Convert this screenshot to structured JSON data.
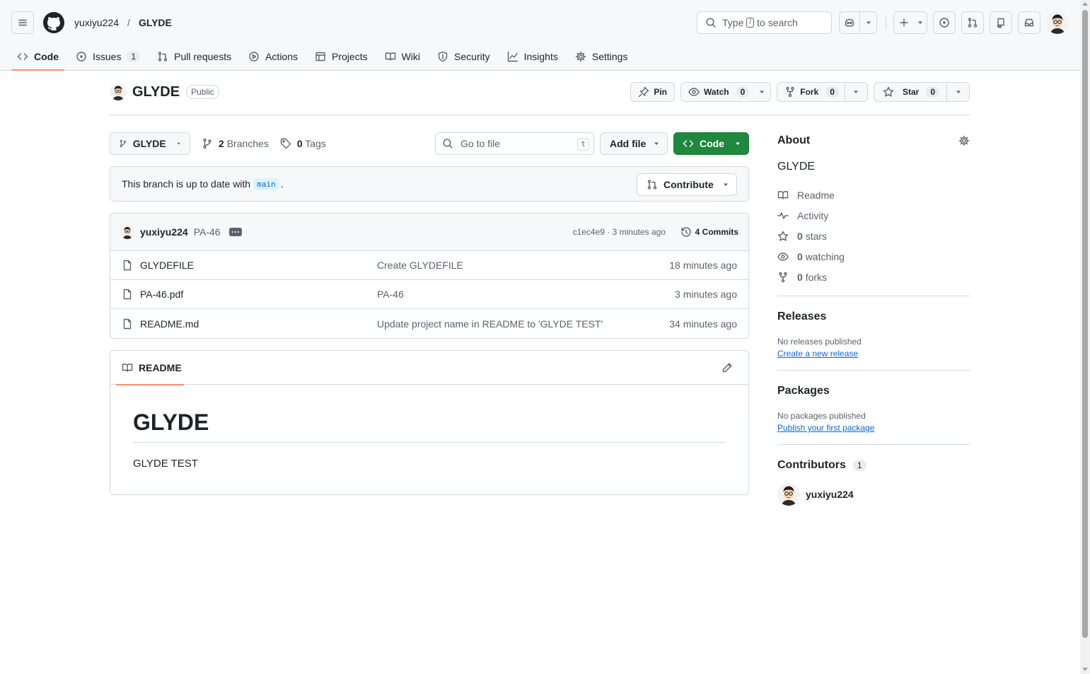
{
  "header": {
    "owner": "yuxiyu224",
    "separator": "/",
    "repo": "GLYDE",
    "search_prefix": "Type",
    "search_key": "/",
    "search_suffix": "to search"
  },
  "tabs": [
    {
      "label": "Code",
      "icon": "code-icon"
    },
    {
      "label": "Issues",
      "icon": "issue-icon",
      "count": "1"
    },
    {
      "label": "Pull requests",
      "icon": "pull-request-icon"
    },
    {
      "label": "Actions",
      "icon": "play-icon"
    },
    {
      "label": "Projects",
      "icon": "table-icon"
    },
    {
      "label": "Wiki",
      "icon": "book-icon"
    },
    {
      "label": "Security",
      "icon": "shield-icon"
    },
    {
      "label": "Insights",
      "icon": "graph-icon"
    },
    {
      "label": "Settings",
      "icon": "gear-icon"
    }
  ],
  "repo": {
    "name": "GLYDE",
    "visibility": "Public",
    "pin_label": "Pin",
    "watch_label": "Watch",
    "watch_count": "0",
    "fork_label": "Fork",
    "fork_count": "0",
    "star_label": "Star",
    "star_count": "0"
  },
  "filenav": {
    "branch": "GLYDE",
    "branches_count": "2",
    "branches_label": "Branches",
    "tags_count": "0",
    "tags_label": "Tags",
    "goto_placeholder": "Go to file",
    "goto_key": "t",
    "add_file": "Add file",
    "code": "Code"
  },
  "branch_info": {
    "text": "This branch is up to date with",
    "base": "main",
    "suffix": ".",
    "contribute": "Contribute"
  },
  "commit": {
    "author": "yuxiyu224",
    "message": "PA-46",
    "meta": "c1ec4e9 · 3 minutes ago",
    "commits": "4 Commits"
  },
  "files": [
    {
      "name": "GLYDEFILE",
      "message": "Create GLYDEFILE",
      "date": "18 minutes ago"
    },
    {
      "name": "PA-46.pdf",
      "message": "PA-46",
      "date": "3 minutes ago"
    },
    {
      "name": "README.md",
      "message": "Update project name in README to 'GLYDE TEST'",
      "date": "34 minutes ago"
    }
  ],
  "readme": {
    "tab": "README",
    "heading": "GLYDE",
    "body": "GLYDE TEST"
  },
  "about": {
    "title": "About",
    "description": "GLYDE",
    "readme": "Readme",
    "activity": "Activity",
    "stars_count": "0",
    "stars_label": "stars",
    "watching_count": "0",
    "watching_label": "watching",
    "forks_count": "0",
    "forks_label": "forks"
  },
  "releases": {
    "title": "Releases",
    "empty": "No releases published",
    "link": "Create a new release"
  },
  "packages": {
    "title": "Packages",
    "empty": "No packages published",
    "link": "Publish your first package"
  },
  "contributors": {
    "title": "Contributors",
    "count": "1",
    "people": [
      {
        "name": "yuxiyu224"
      }
    ]
  },
  "colors": {
    "accent": "#fd8c73",
    "primary_button": "#1f883d",
    "link": "#0969da"
  }
}
